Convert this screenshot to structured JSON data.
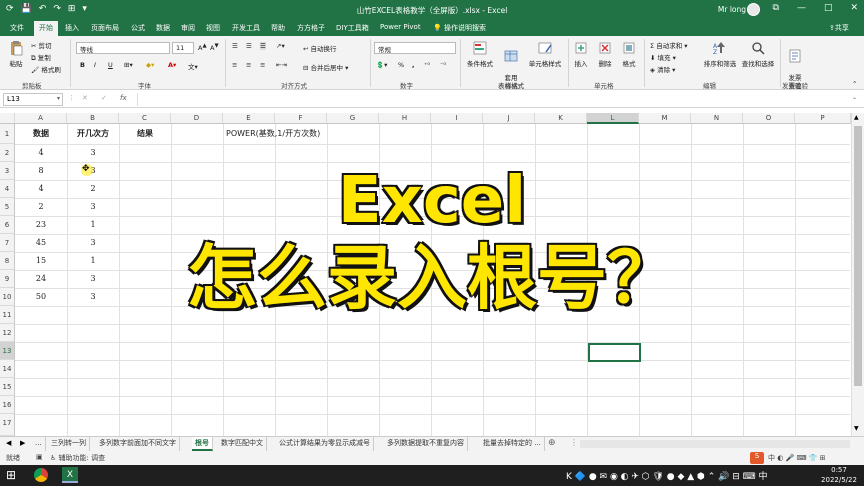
{
  "window": {
    "title": "山竹EXCEL表格教学（全屏版）.xlsx - Excel",
    "user": "Mr long",
    "colors": {
      "accent": "#217346",
      "overlay_text": "#ffe600"
    }
  },
  "ribbon_tabs": [
    "文件",
    "开始",
    "插入",
    "页面布局",
    "公式",
    "数据",
    "审阅",
    "视图",
    "开发工具",
    "帮助",
    "方方格子",
    "DIY工具箱",
    "Power Pivot"
  ],
  "tell_me": "操作说明搜索",
  "share": "共享",
  "ribbon": {
    "clipboard": {
      "paste": "粘贴",
      "cut": "剪切",
      "copy": "复制",
      "format_painter": "格式刷",
      "label": "剪贴板"
    },
    "font": {
      "name": "等线",
      "size": "11",
      "bold": "B",
      "italic": "I",
      "underline": "U",
      "label": "字体",
      "font_color": "A"
    },
    "alignment": {
      "wrap": "自动换行",
      "merge": "合并后居中",
      "label": "对齐方式"
    },
    "number": {
      "format": "常规",
      "percent": "%",
      "comma": ",",
      "label": "数字"
    },
    "styles": {
      "conditional": "条件格式",
      "table": "套用\n表格格式",
      "cell_styles": "单元格样式",
      "label": "样式"
    },
    "cells": {
      "insert": "插入",
      "delete": "删除",
      "format": "格式",
      "label": "单元格"
    },
    "editing": {
      "autosum": "自动求和",
      "fill": "填充",
      "clear": "清除",
      "sort": "排序和筛选",
      "find": "查找和选择",
      "label": "编辑"
    },
    "invoice": {
      "check": "发票\n查验",
      "label": "发票查验"
    }
  },
  "formula_bar": {
    "name_box": "L13",
    "fx": "fx",
    "cancel": "✕",
    "confirm": "✓"
  },
  "columns": [
    "A",
    "B",
    "C",
    "D",
    "E",
    "F",
    "G",
    "H",
    "I",
    "J",
    "K",
    "L",
    "M",
    "N",
    "O",
    "P"
  ],
  "rows": [
    "1",
    "2",
    "3",
    "4",
    "5",
    "6",
    "7",
    "8",
    "9",
    "10",
    "11",
    "12",
    "13",
    "14",
    "15",
    "16",
    "17"
  ],
  "cells": {
    "A1": "数据",
    "B1": "开几次方",
    "C1": "结果",
    "E1": "POWER(基数,1/开方次数)",
    "A2": "4",
    "B2": "3",
    "A3": "8",
    "B3": "3",
    "A4": "4",
    "B4": "2",
    "A5": "2",
    "B5": "3",
    "A6": "23",
    "B6": "1",
    "A7": "45",
    "B7": "3",
    "A8": "15",
    "B8": "1",
    "A9": "24",
    "B9": "3",
    "A10": "50",
    "B10": "3"
  },
  "overlay": {
    "line1": "Excel",
    "line2": "怎么录入根号？"
  },
  "sheet_tabs": [
    "...",
    "三列转一列",
    "多列数字前面加不同文字",
    "根号",
    "数字匹配中文",
    "公式计算结果为零显示成减号",
    "多列数据提取不重复内容",
    "批量去掉特定的 ..."
  ],
  "active_sheet": "根号",
  "status": {
    "ready": "就绪",
    "accessibility": "辅助功能: 调查"
  },
  "taskbar": {
    "time": "0:57",
    "date": "2022/5/22"
  }
}
